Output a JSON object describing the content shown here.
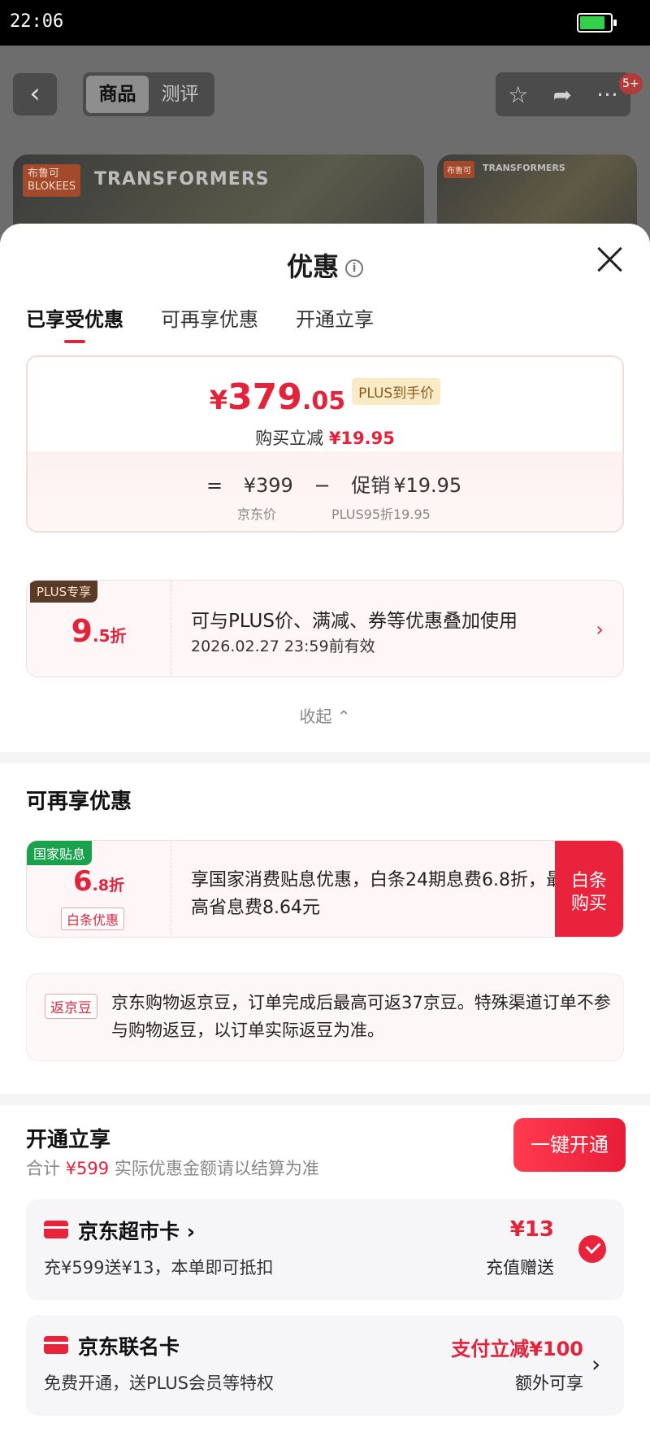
{
  "status_bar": {
    "time": "22:06",
    "battery_level": 0.85
  },
  "background_page": {
    "back_icon": "chevron-left-icon",
    "tabs": [
      "商品",
      "测评"
    ],
    "actions": [
      "star-icon",
      "share-icon",
      "more-icon"
    ],
    "message_badge": "5+",
    "banner": {
      "brand_logo": "布鲁可\nBLOKEES",
      "brand_name": "TRANSFORMERS"
    }
  },
  "sheet": {
    "title": "优惠",
    "info_icon": "info-icon",
    "close_icon": "close-icon",
    "tabs": [
      "已享受优惠",
      "可再享优惠",
      "开通立享"
    ],
    "price_card": {
      "yen": "¥",
      "final_int": "379",
      "final_dec": ".05",
      "plus_tag": "PLUS到手价",
      "reduce_label": "购买立减",
      "reduce_value": "¥19.95",
      "formula_eq": "=",
      "jd_price": "¥399",
      "minus": "−",
      "promo_label": "促销",
      "promo_value": "¥19.95",
      "jd_price_label": "京东价",
      "promo_sub": "PLUS95折19.95"
    },
    "plus_card": {
      "badge": "PLUS专享",
      "discount_big": "9",
      "discount_small": ".5折",
      "line1": "可与PLUS价、满减、券等优惠叠加使用",
      "line2": "2026.02.27  23:59前有效"
    },
    "collapse_label": "收起 ⌃",
    "more_offers": {
      "title": "可再享优惠",
      "subsidy": {
        "badge": "国家贴息",
        "discount_big": "6",
        "discount_small": ".8折",
        "tag": "白条优惠",
        "text": "享国家消费贴息优惠，白条24期息费6.8折，最高省息费8.64元",
        "button_line1": "白条",
        "button_line2": "购买"
      },
      "beans": {
        "tag": "返京豆",
        "text": "京东购物返京豆，订单完成后最高可返37京豆。特殊渠道订单不参与购物返豆，以订单实际返豆为准。"
      }
    },
    "open_section": {
      "title": "开通立享",
      "total_label": "合计",
      "total_value": "¥599",
      "total_note": "实际优惠金额请以结算为准",
      "open_button": "一键开通",
      "offers": [
        {
          "name": "京东超市卡 ›",
          "desc": "充¥599送¥13，本单即可抵扣",
          "value": "¥13",
          "sub": "充值赠送",
          "checked": true
        },
        {
          "name": "京东联名卡",
          "desc": "免费开通，送PLUS会员等特权",
          "value": "支付立减¥100",
          "sub": "额外可享",
          "checked": false
        }
      ]
    }
  },
  "colors": {
    "accent": "#e2233a",
    "plus_tag_bg": "#fbeac6",
    "green_badge": "#1aa14b"
  }
}
